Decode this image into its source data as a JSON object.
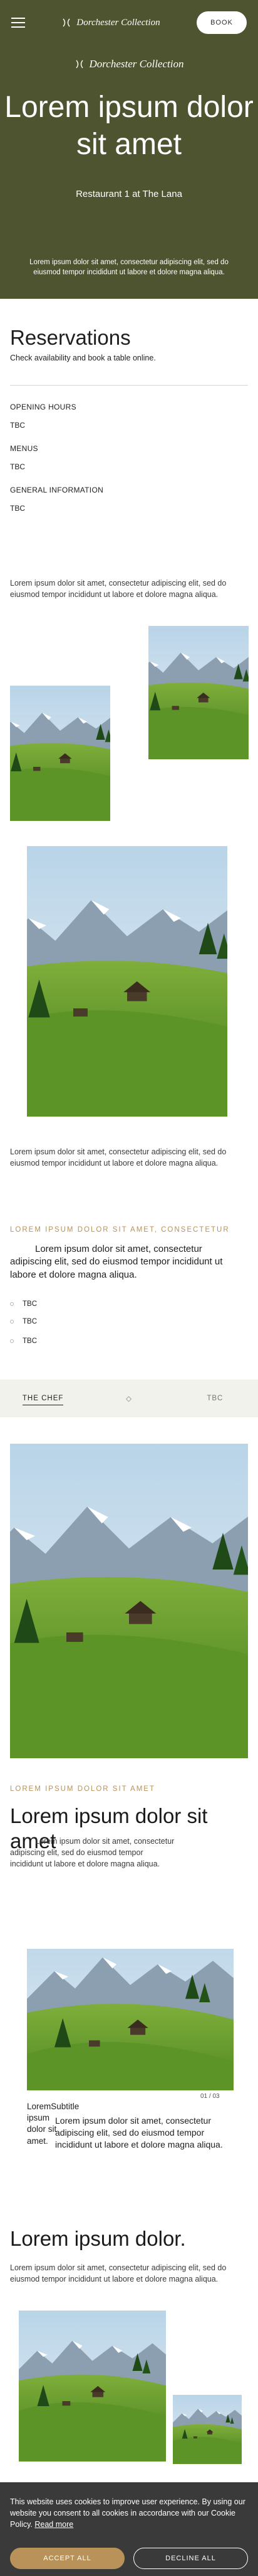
{
  "header": {
    "brand": "Dorchester Collection",
    "book_label": "BOOK"
  },
  "hero": {
    "brand": "Dorchester Collection",
    "title": "Lorem ipsum dolor sit amet",
    "subtitle": "Restaurant 1 at The Lana",
    "text": "Lorem ipsum dolor sit amet, consectetur adipiscing elit, sed do eiusmod tempor incididunt ut labore et dolore magna aliqua."
  },
  "reservations": {
    "title": "Reservations",
    "subtitle": "Check availability and book a table online.",
    "sections": [
      {
        "label": "OPENING HOURS",
        "value": "TBC"
      },
      {
        "label": "MENUS",
        "value": "TBC"
      },
      {
        "label": "GENERAL INFORMATION",
        "value": "TBC"
      }
    ]
  },
  "intro_paragraph": "Lorem ipsum dolor sit amet, consectetur adipiscing elit, sed do eiusmod tempor incididunt ut labore et dolore magna aliqua.",
  "gallery_paragraph": "Lorem ipsum dolor sit amet, consectetur adipiscing elit, sed do eiusmod tempor incididunt ut labore et dolore magna aliqua.",
  "feature": {
    "eyebrow": "LOREM IPSUM DOLOR SIT AMET, CONSECTETUR",
    "text": "Lorem ipsum dolor sit amet, consectetur adipiscing elit, sed do eiusmod tempor incididunt ut labore et dolore magna aliqua.",
    "items": [
      "TBC",
      "TBC",
      "TBC"
    ]
  },
  "tabs": [
    {
      "label": "THE CHEF",
      "active": true
    },
    {
      "label": "TBC",
      "active": false
    }
  ],
  "chef": {
    "eyebrow": "LOREM IPSUM DOLOR SIT AMET",
    "title": "Lorem ipsum dolor sit amet",
    "text": "Lorem ipsum dolor sit amet, consectetur adipiscing elit, sed do eiusmod tempor incididunt ut labore et dolore magna aliqua."
  },
  "slider": {
    "counter": "01",
    "counter_total": "/ 03",
    "caption_head": "LoremSubtitle ipsum dolor sit amet.",
    "caption_body": "Lorem ipsum dolor sit amet, consectetur adipiscing elit, sed do eiusmod tempor incididunt ut labore et dolore magna aliqua."
  },
  "closing": {
    "title": "Lorem ipsum dolor.",
    "text": "Lorem ipsum dolor sit amet, consectetur adipiscing elit, sed do eiusmod tempor incididunt ut labore et dolore magna aliqua."
  },
  "cookie": {
    "text": "This website uses cookies to improve user experience. By using our website you consent to all cookies in accordance with our Cookie Policy.",
    "link": "Read more",
    "accept": "ACCEPT ALL",
    "decline": "DECLINE ALL"
  },
  "colors": {
    "hero_bg": "#4e5430",
    "accent": "#b89258",
    "cookie_bg": "#3a3a3a",
    "tab_bg": "#f2f2ec"
  },
  "icons": [
    "menu-icon",
    "brand-logo-icon",
    "dot-icon"
  ]
}
